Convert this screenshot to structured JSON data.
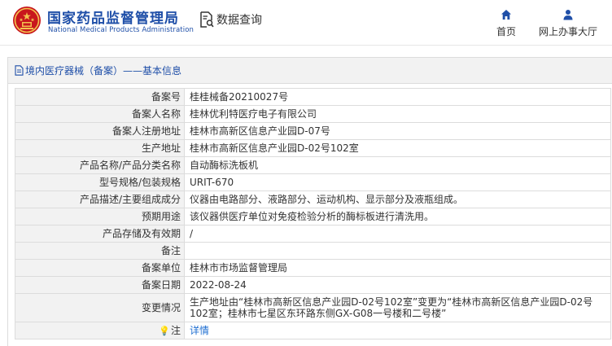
{
  "header": {
    "brand_cn": "国家药品监督管理局",
    "brand_en": "National Medical Products Administration",
    "query_label": "数据查询",
    "nav": [
      {
        "label": "首页",
        "icon": "home-icon"
      },
      {
        "label": "网上办事大厅",
        "icon": "user-icon"
      }
    ]
  },
  "panel": {
    "title": "境内医疗器械（备案）——基本信息"
  },
  "rows": [
    {
      "label": "备案号",
      "value": "桂桂械备20210027号"
    },
    {
      "label": "备案人名称",
      "value": "桂林优利特医疗电子有限公司"
    },
    {
      "label": "备案人注册地址",
      "value": "桂林市高新区信息产业园D-07号"
    },
    {
      "label": "生产地址",
      "value": "桂林市高新区信息产业园D-02号102室"
    },
    {
      "label": "产品名称/产品分类名称",
      "value": "自动酶标洗板机"
    },
    {
      "label": "型号规格/包装规格",
      "value": "URIT-670"
    },
    {
      "label": "产品描述/主要组成成分",
      "value": "仪器由电路部分、液路部分、运动机构、显示部分及液瓶组成。"
    },
    {
      "label": "预期用途",
      "value": "该仪器供医疗单位对免疫检验分析的酶标板进行清洗用。"
    },
    {
      "label": "产品存储及有效期",
      "value": "/"
    },
    {
      "label": "备注",
      "value": ""
    },
    {
      "label": "备案单位",
      "value": "桂林市市场监督管理局"
    },
    {
      "label": "备案日期",
      "value": "2022-08-24"
    },
    {
      "label": "变更情况",
      "value": "生产地址由“桂林市高新区信息产业园D-02号102室”变更为“桂林市高新区信息产业园D-02号102室；桂林市七星区东环路东侧GX-G08一号楼和二号楼”"
    },
    {
      "label": "注",
      "value": "详情"
    }
  ],
  "colors": {
    "brand_blue": "#1f4fa8",
    "link_blue": "#1f6fd1",
    "label_bg": "#f2f2f2",
    "border": "#dcdcdc"
  }
}
